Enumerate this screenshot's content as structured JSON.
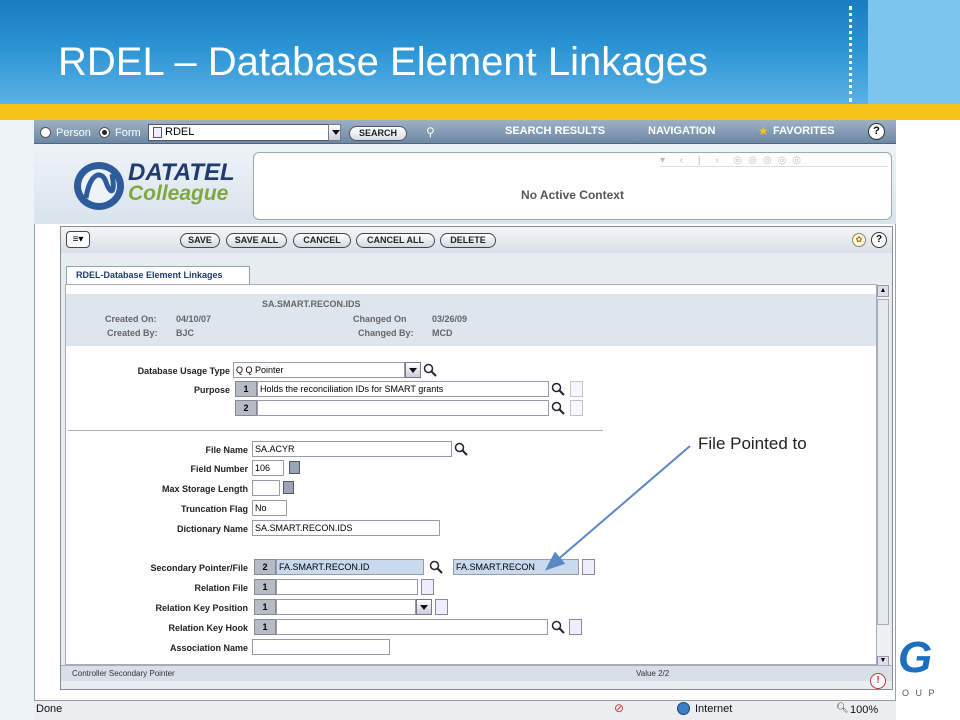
{
  "slide": {
    "title": "RDEL – Database Element Linkages"
  },
  "topbar": {
    "person_label": "Person",
    "form_label": "Form",
    "form_value": "RDEL",
    "search_label": "SEARCH",
    "nav": [
      "SEARCH RESULTS",
      "NAVIGATION",
      "FAVORITES"
    ],
    "help": "?"
  },
  "logo": {
    "line1": "DATATEL",
    "line2": "Colleague"
  },
  "context": {
    "text": "No Active Context"
  },
  "toolbar": {
    "buttons": [
      "SAVE",
      "SAVE ALL",
      "CANCEL",
      "CANCEL ALL",
      "DELETE"
    ]
  },
  "tab": {
    "label": "RDEL-Database Element Linkages"
  },
  "info": {
    "id": "SA.SMART.RECON.IDS",
    "created_on_label": "Created On:",
    "created_on": "04/10/07",
    "created_by_label": "Created By:",
    "created_by": "BJC",
    "changed_on_label": "Changed On",
    "changed_on": "03/26/09",
    "changed_by_label": "Changed By:",
    "changed_by": "MCD"
  },
  "fields": {
    "usage_type_label": "Database Usage Type",
    "usage_type": "Q Q Pointer",
    "purpose_label": "Purpose",
    "purpose_num1": "1",
    "purpose1": "Holds the reconciliation IDs for SMART grants",
    "purpose_num2": "2",
    "purpose2": "",
    "file_name_label": "File Name",
    "file_name": "SA.ACYR",
    "field_number_label": "Field Number",
    "field_number": "106",
    "max_storage_label": "Max Storage Length",
    "max_storage": "",
    "truncation_label": "Truncation Flag",
    "truncation": "No",
    "dict_name_label": "Dictionary Name",
    "dict_name": "SA.SMART.RECON.IDS",
    "sec_pointer_label": "Secondary Pointer/File",
    "sec_pointer_num": "2",
    "sec_pointer": "FA.SMART.RECON.ID",
    "sec_file": "FA.SMART.RECON",
    "relation_file_label": "Relation File",
    "relation_file_num": "1",
    "relation_key_pos_label": "Relation Key Position",
    "relation_key_pos_num": "1",
    "relation_key_hook_label": "Relation Key Hook",
    "relation_key_hook_num": "1",
    "assoc_name_label": "Association Name"
  },
  "status": {
    "left": "Controller Secondary Pointer",
    "right": "Value 2/2"
  },
  "ie": {
    "done": "Done",
    "zone": "Internet",
    "zoom": "100%"
  },
  "annotation": {
    "text": "File Pointed to"
  },
  "brand": {
    "oup": "O U P"
  }
}
